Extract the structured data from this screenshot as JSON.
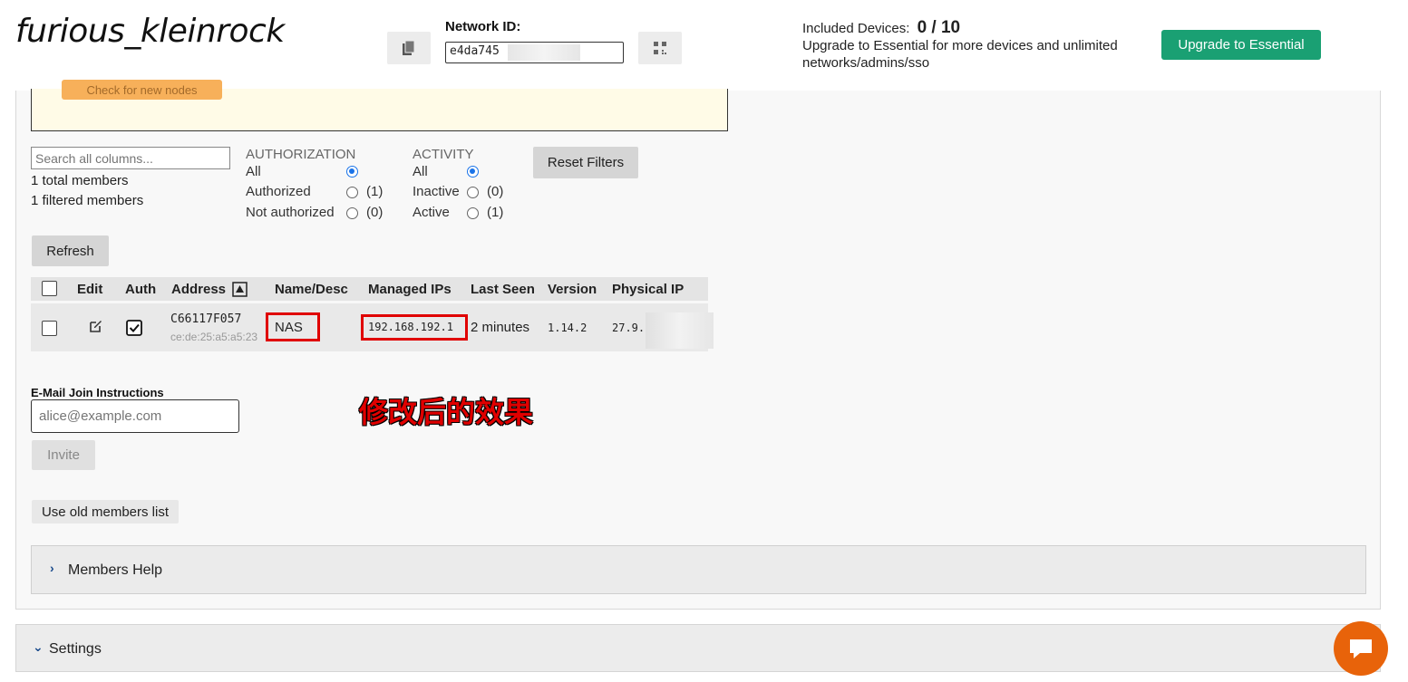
{
  "header": {
    "network_name": "furious_kleinrock",
    "network_id_label": "Network ID:",
    "network_id_value": "e4da745",
    "included_devices_label": "Included Devices:",
    "included_devices_count": "0 / 10",
    "upgrade_text_line1": "Upgrade to Essential for more devices and unlimited",
    "upgrade_text_line2": "networks/admins/sso",
    "upgrade_button": "Upgrade to Essential"
  },
  "notice": {
    "button_label": "Check for new nodes"
  },
  "filters": {
    "search_placeholder": "Search all columns...",
    "total_members": "1 total members",
    "filtered_members": "1 filtered members",
    "authorization": {
      "heading": "AUTHORIZATION",
      "options": [
        {
          "label": "All",
          "count": "",
          "selected": true
        },
        {
          "label": "Authorized",
          "count": "(1)",
          "selected": false
        },
        {
          "label": "Not authorized",
          "count": "(0)",
          "selected": false
        }
      ]
    },
    "activity": {
      "heading": "ACTIVITY",
      "options": [
        {
          "label": "All",
          "count": "",
          "selected": true
        },
        {
          "label": "Inactive",
          "count": "(0)",
          "selected": false
        },
        {
          "label": "Active",
          "count": "(1)",
          "selected": false
        }
      ]
    },
    "reset_button": "Reset Filters",
    "refresh_button": "Refresh"
  },
  "table": {
    "headers": {
      "edit": "Edit",
      "auth": "Auth",
      "address": "Address",
      "name": "Name/Desc",
      "managed_ips": "Managed IPs",
      "last_seen": "Last Seen",
      "version": "Version",
      "physical_ip": "Physical IP"
    },
    "rows": [
      {
        "address": "C66117F057",
        "mac": "ce:de:25:a5:a5:23",
        "name": "NAS",
        "managed_ip": "192.168.192.1",
        "last_seen": "2 minutes",
        "version": "1.14.2",
        "physical_ip": "27.9.",
        "authorized": true
      }
    ]
  },
  "invite": {
    "label": "E-Mail Join Instructions",
    "placeholder": "alice@example.com",
    "button": "Invite"
  },
  "annotation": "修改后的效果",
  "old_members_button": "Use old members list",
  "members_help": "Members Help",
  "settings": "Settings",
  "colors": {
    "accent_green": "#1aa073",
    "highlight_red": "#e00000",
    "chat_orange": "#e8630a",
    "radio_blue": "#1a73e8"
  }
}
